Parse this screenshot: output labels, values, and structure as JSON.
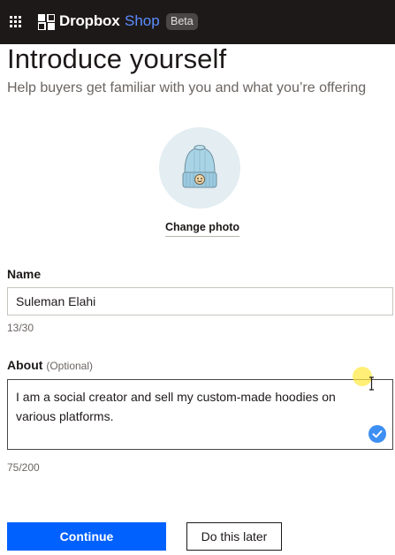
{
  "header": {
    "brand": "Dropbox",
    "brand_suffix": "Shop",
    "badge": "Beta",
    "menu_icon": "app-grid-icon",
    "logo_icon": "dropbox-logo-icon"
  },
  "intro": {
    "title": "Introduce yourself",
    "subtitle": "Help buyers get familiar with you and what you’re offering"
  },
  "photo": {
    "image": "beanie-hat-avatar",
    "change_label": "Change photo"
  },
  "name_field": {
    "label": "Name",
    "value": "Suleman Elahi",
    "counter": "13/30"
  },
  "about_field": {
    "label": "About",
    "optional": "(Optional)",
    "value": "I am a social creator and sell my custom-made hoodies on various platforms.",
    "counter": "75/200",
    "status_icon": "check-circle-icon"
  },
  "actions": {
    "continue_label": "Continue",
    "later_label": "Do this later"
  },
  "colors": {
    "primary": "#0061fe",
    "topbar": "#1e1919",
    "shop_text": "#5b8dff",
    "check": "#3d8ff2"
  }
}
